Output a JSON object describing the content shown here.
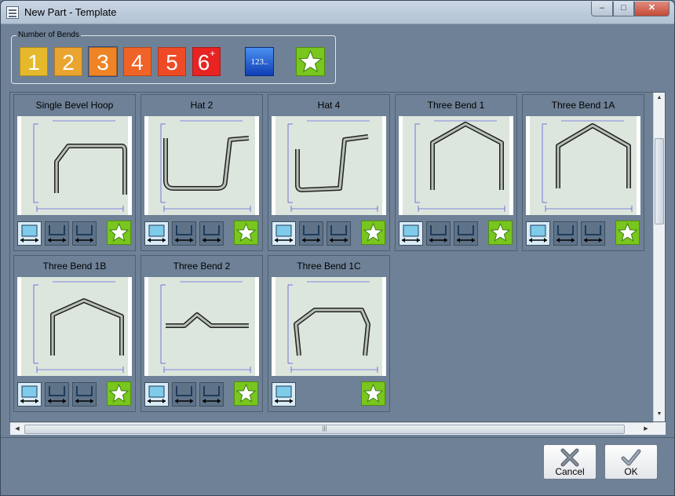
{
  "window": {
    "title": "New Part - Template",
    "controls": {
      "minimize": "–",
      "maximize": "□",
      "close": "✕"
    }
  },
  "bends": {
    "legend": "Number of Bends",
    "buttons": [
      {
        "label": "1",
        "color": "#e6b92c"
      },
      {
        "label": "2",
        "color": "#eaa530"
      },
      {
        "label": "3",
        "color": "#ee8425",
        "selected": true
      },
      {
        "label": "4",
        "color": "#ef6326"
      },
      {
        "label": "5",
        "color": "#ef4a26"
      },
      {
        "label": "6",
        "sup": "+",
        "color": "#e92222"
      }
    ],
    "numbered": "123..",
    "favorites_icon": "star-icon"
  },
  "templates": [
    {
      "name": "Single Bevel Hoop",
      "options": 3,
      "selected": 0
    },
    {
      "name": "Hat 2",
      "options": 3,
      "selected": 0
    },
    {
      "name": "Hat 4",
      "options": 3,
      "selected": 0
    },
    {
      "name": "Three Bend 1",
      "options": 3,
      "selected": 0
    },
    {
      "name": "Three Bend 1A",
      "options": 3,
      "selected": 0
    },
    {
      "name": "Three Bend 1B",
      "options": 3,
      "selected": 0
    },
    {
      "name": "Three Bend 2",
      "options": 3,
      "selected": 0
    },
    {
      "name": "Three Bend 1C",
      "options": 1,
      "selected": 0
    }
  ],
  "buttons": {
    "cancel": "Cancel",
    "ok": "OK"
  },
  "colors": {
    "accent_green": "#78c61e",
    "window_bg": "#6e8196"
  }
}
